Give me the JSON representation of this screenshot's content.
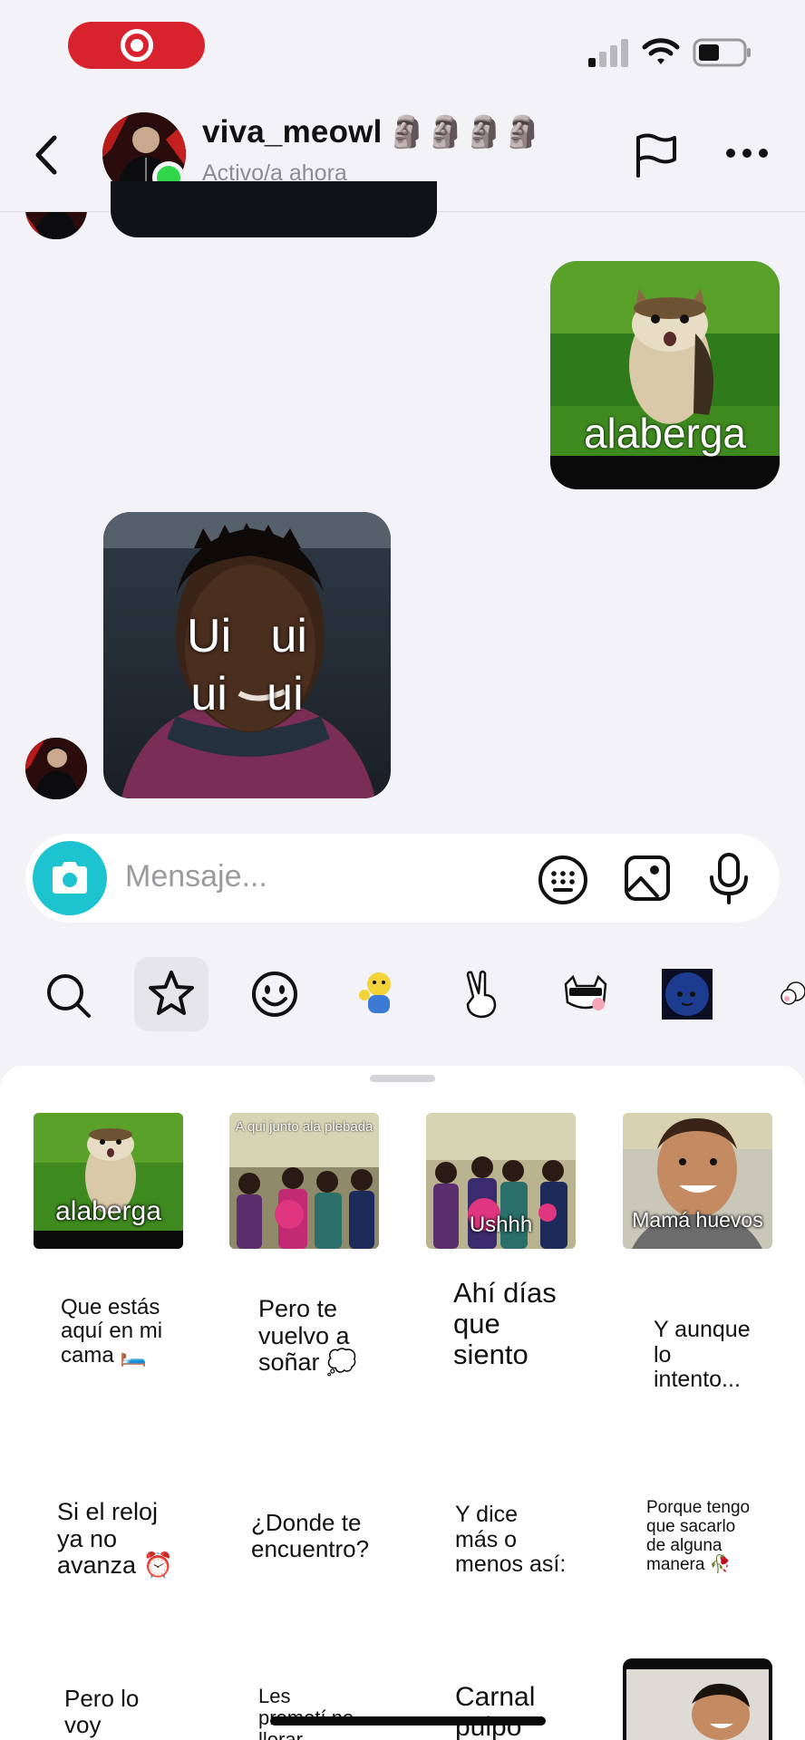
{
  "colors": {
    "background": "#f3f2f7",
    "record_pill": "#d8232f",
    "online": "#31d64a",
    "camera_button": "#1ec3d0"
  },
  "status_bar": {
    "icons": [
      "screen-record-icon",
      "cellular-signal-icon",
      "wifi-icon",
      "battery-icon"
    ]
  },
  "header": {
    "username": "viva_meowl",
    "username_emojis": "🗿🗿🗿🗿",
    "status": "Activo/a ahora",
    "icons": [
      "back-arrow-icon",
      "flag-icon",
      "more-icon"
    ]
  },
  "messages": [
    {
      "from": "me",
      "type": "sticker",
      "caption": "alaberga"
    },
    {
      "from": "them",
      "type": "sticker",
      "caption_line1": "Ui   ui",
      "caption_line2": "ui   ui"
    }
  ],
  "composer": {
    "placeholder": "Mensaje...",
    "icons": [
      "camera-icon",
      "sticker-keyboard-icon",
      "gallery-icon",
      "microphone-icon"
    ]
  },
  "tray": {
    "tabs": [
      "search-icon",
      "star-icon",
      "smiley-icon",
      "pack-character",
      "pack-peace-hand",
      "pack-cat",
      "pack-moon",
      "pack-sheep"
    ],
    "selected": "star-icon"
  },
  "stickers": {
    "row1": [
      {
        "type": "image",
        "caption": "alaberga"
      },
      {
        "type": "image",
        "caption": "A qui junto ala plebada"
      },
      {
        "type": "image",
        "caption": "Ushhh"
      },
      {
        "type": "image",
        "caption": "Mamá huevos"
      }
    ],
    "row2": [
      {
        "l1": "Que estás",
        "l2": "aquí en mi",
        "l3": "cama 🛏️"
      },
      {
        "l1": "Pero te",
        "l2": "vuelvo a",
        "l3": "soñar 💭"
      },
      {
        "l1": "Ahí días",
        "l2": "que",
        "l3": "siento"
      },
      {
        "l1": "Y aunque",
        "l2": "lo",
        "l3": "intento..."
      }
    ],
    "row3": [
      {
        "l1": "Si el reloj",
        "l2": "ya no",
        "l3": "avanza ⏰"
      },
      {
        "l1": "¿Donde te",
        "l2": "encuentro?",
        "l3": ""
      },
      {
        "l1": "Y dice",
        "l2": "más o",
        "l3": "menos así:"
      },
      {
        "l1": "Porque tengo",
        "l2": "que sacarlo",
        "l3": "de alguna",
        "l4": "manera 🥀"
      }
    ],
    "row4": [
      {
        "l1": "Pero lo",
        "l2": "voy"
      },
      {
        "l1": "Les",
        "l2": "prometí no",
        "l3": "llorar"
      },
      {
        "l1": "Carnal",
        "l2": "pulpo"
      },
      {
        "type": "image"
      }
    ]
  }
}
